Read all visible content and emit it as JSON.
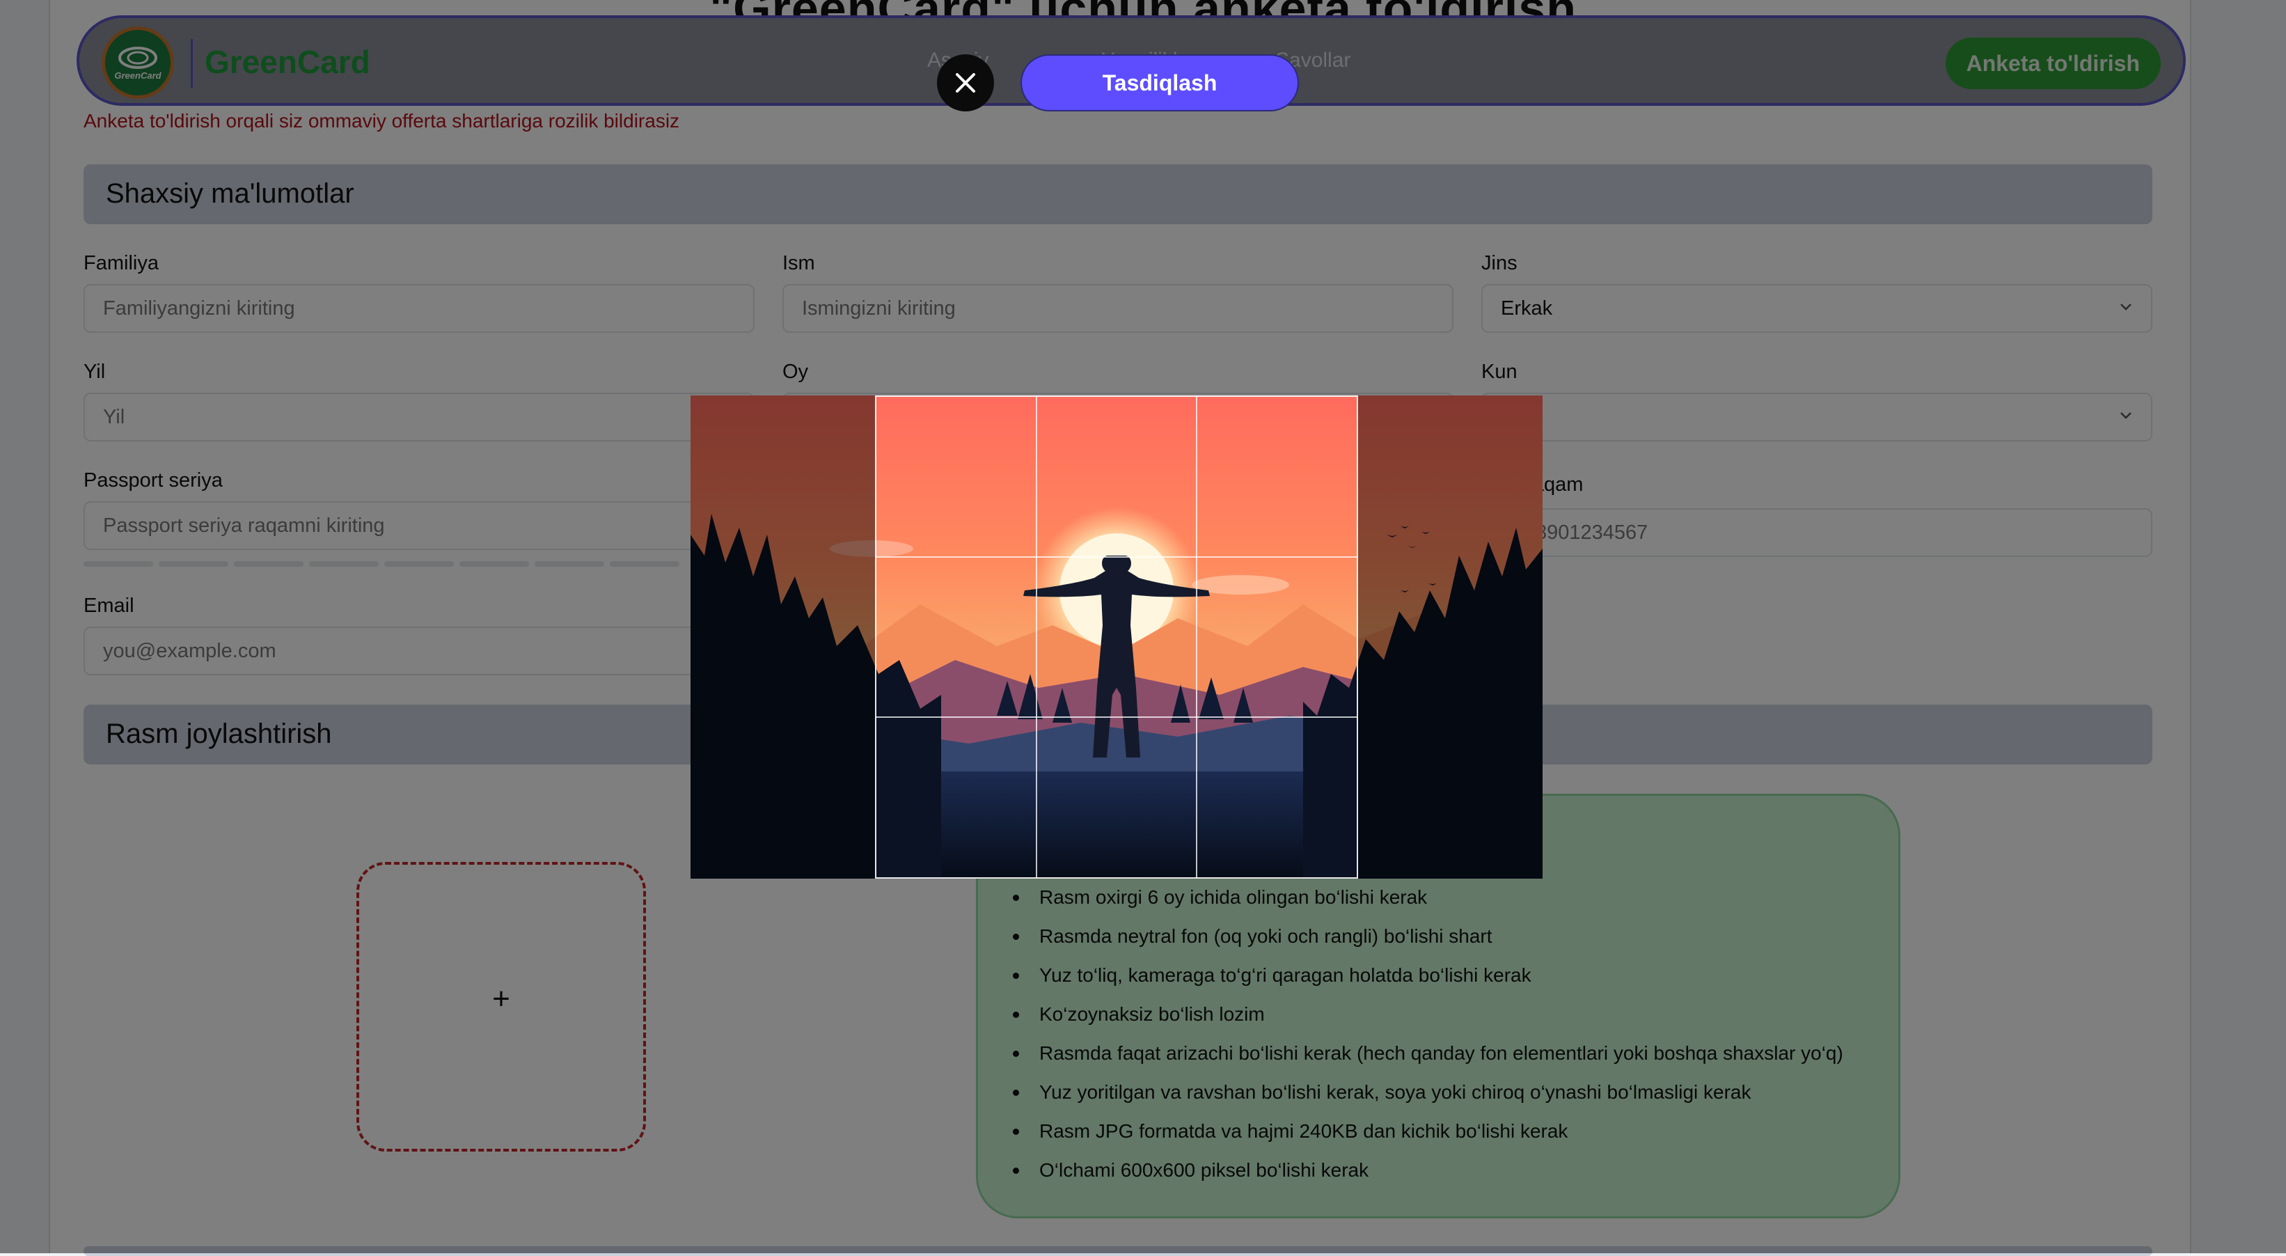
{
  "page": {
    "title": "\"GreenCard\" uchun anketa to'ldirish"
  },
  "navbar": {
    "logo_badge_text": "GreenCard",
    "logo_text": "GreenCard",
    "links": [
      "Asosiy",
      "Yangiliklar",
      "Savollar"
    ],
    "cta_label": "Anketa to'ldirish"
  },
  "consent_note": "Anketa to'ldirish orqali siz ommaviy offerta shartlariga rozilik bildirasiz",
  "personal_section": {
    "title": "Shaxsiy ma'lumotlar",
    "fields": {
      "surname": {
        "label": "Familiya",
        "placeholder": "Familiyangizni kiriting"
      },
      "name": {
        "label": "Ism",
        "placeholder": "Ismingizni kiriting"
      },
      "gender": {
        "label": "Jins",
        "value": "Erkak"
      },
      "year": {
        "label": "Yil",
        "placeholder": "Yil"
      },
      "month": {
        "label": "Oy"
      },
      "day": {
        "label": "Kun"
      },
      "passport": {
        "label": "Passport seriya",
        "placeholder": "Passport seriya raqamni kiriting"
      },
      "phone": {
        "label_visible": "n raqam",
        "placeholder_visible": "8901234567"
      },
      "email": {
        "label": "Email",
        "placeholder": "you@example.com"
      }
    }
  },
  "photo_section": {
    "title": "Rasm joylashtirish",
    "upload_glyph": "+",
    "requirements": [
      "Rasm oxirgi 6 oy ichida olingan bo‘lishi kerak",
      "Rasmda neytral fon (oq yoki och rangli) bo‘lishi shart",
      "Yuz to‘liq, kameraga to‘g‘ri qaragan holatda bo‘lishi kerak",
      "Ko‘zoynaksiz bo‘lish lozim",
      "Rasmda faqat arizachi bo‘lishi kerak (hech qanday fon elementlari yoki boshqa shaxslar yo‘q)",
      "Yuz yoritilgan va ravshan bo‘lishi kerak, soya yoki chiroq o‘ynashi bo‘lmasligi kerak",
      "Rasm JPG formatda va hajmi 240KB dan kichik bo‘lishi kerak",
      "O‘lchami 600x600 piksel bo‘lishi kerak"
    ]
  },
  "crop_modal": {
    "confirm_label": "Tasdiqlash",
    "close_icon": "close-icon",
    "image_subject": "silhouette-at-sunset-mountains"
  },
  "colors": {
    "accent": "#5d4dff",
    "brand_green": "#2e9a34",
    "error_red": "#b3121a",
    "section_bg": "#cbd0dd",
    "requirements_bg": "#c7f0cf"
  }
}
